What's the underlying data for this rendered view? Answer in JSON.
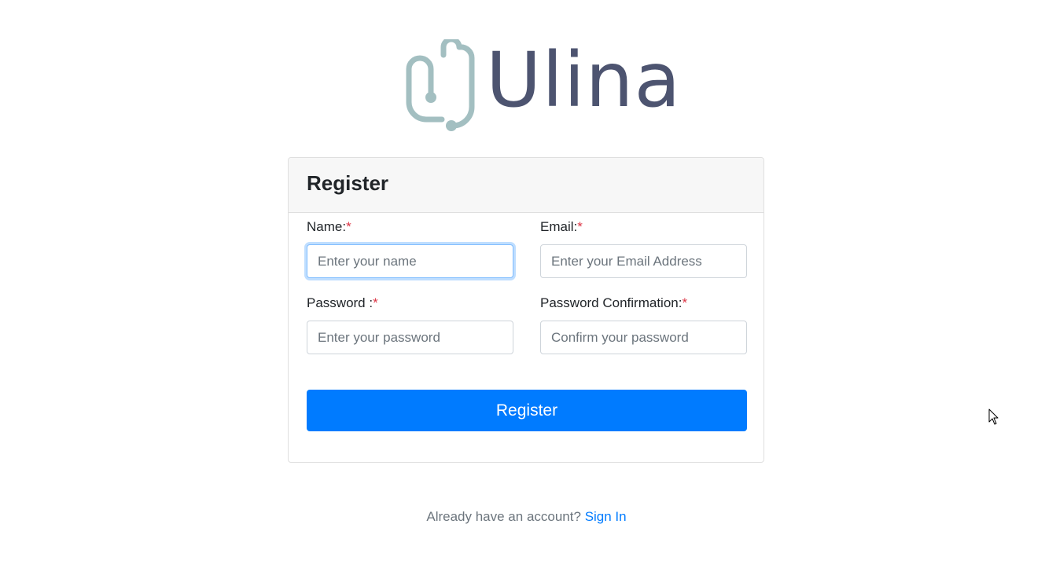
{
  "brand": {
    "name": "Ulina",
    "colors": {
      "mark": "#a3bfc1",
      "text": "#4d5470"
    }
  },
  "card": {
    "title": "Register"
  },
  "form": {
    "name": {
      "label": "Name:",
      "required": "*",
      "placeholder": "Enter your name",
      "value": ""
    },
    "email": {
      "label": "Email:",
      "required": "*",
      "placeholder": "Enter your Email Address",
      "value": ""
    },
    "password": {
      "label": "Password :",
      "required": "*",
      "placeholder": "Enter your password",
      "value": ""
    },
    "password_confirmation": {
      "label": "Password Confirmation:",
      "required": "*",
      "placeholder": "Confirm your password",
      "value": ""
    },
    "submit_label": "Register"
  },
  "footer": {
    "prompt": "Already have an account?",
    "link_label": "Sign In"
  },
  "colors": {
    "primary": "#007bff",
    "required": "#dc3545"
  },
  "icons": {
    "cursor": "mouse-pointer-icon"
  }
}
